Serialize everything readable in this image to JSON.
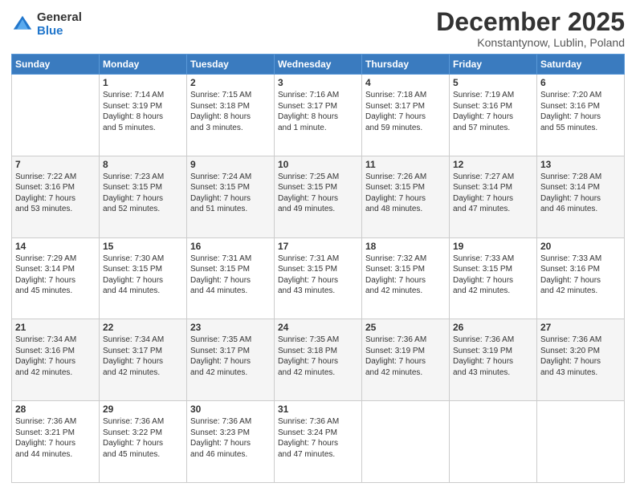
{
  "logo": {
    "general": "General",
    "blue": "Blue"
  },
  "header": {
    "month": "December 2025",
    "location": "Konstantynow, Lublin, Poland"
  },
  "weekdays": [
    "Sunday",
    "Monday",
    "Tuesday",
    "Wednesday",
    "Thursday",
    "Friday",
    "Saturday"
  ],
  "weeks": [
    [
      {
        "day": "",
        "info": ""
      },
      {
        "day": "1",
        "info": "Sunrise: 7:14 AM\nSunset: 3:19 PM\nDaylight: 8 hours\nand 5 minutes."
      },
      {
        "day": "2",
        "info": "Sunrise: 7:15 AM\nSunset: 3:18 PM\nDaylight: 8 hours\nand 3 minutes."
      },
      {
        "day": "3",
        "info": "Sunrise: 7:16 AM\nSunset: 3:17 PM\nDaylight: 8 hours\nand 1 minute."
      },
      {
        "day": "4",
        "info": "Sunrise: 7:18 AM\nSunset: 3:17 PM\nDaylight: 7 hours\nand 59 minutes."
      },
      {
        "day": "5",
        "info": "Sunrise: 7:19 AM\nSunset: 3:16 PM\nDaylight: 7 hours\nand 57 minutes."
      },
      {
        "day": "6",
        "info": "Sunrise: 7:20 AM\nSunset: 3:16 PM\nDaylight: 7 hours\nand 55 minutes."
      }
    ],
    [
      {
        "day": "7",
        "info": "Sunrise: 7:22 AM\nSunset: 3:16 PM\nDaylight: 7 hours\nand 53 minutes."
      },
      {
        "day": "8",
        "info": "Sunrise: 7:23 AM\nSunset: 3:15 PM\nDaylight: 7 hours\nand 52 minutes."
      },
      {
        "day": "9",
        "info": "Sunrise: 7:24 AM\nSunset: 3:15 PM\nDaylight: 7 hours\nand 51 minutes."
      },
      {
        "day": "10",
        "info": "Sunrise: 7:25 AM\nSunset: 3:15 PM\nDaylight: 7 hours\nand 49 minutes."
      },
      {
        "day": "11",
        "info": "Sunrise: 7:26 AM\nSunset: 3:15 PM\nDaylight: 7 hours\nand 48 minutes."
      },
      {
        "day": "12",
        "info": "Sunrise: 7:27 AM\nSunset: 3:14 PM\nDaylight: 7 hours\nand 47 minutes."
      },
      {
        "day": "13",
        "info": "Sunrise: 7:28 AM\nSunset: 3:14 PM\nDaylight: 7 hours\nand 46 minutes."
      }
    ],
    [
      {
        "day": "14",
        "info": "Sunrise: 7:29 AM\nSunset: 3:14 PM\nDaylight: 7 hours\nand 45 minutes."
      },
      {
        "day": "15",
        "info": "Sunrise: 7:30 AM\nSunset: 3:15 PM\nDaylight: 7 hours\nand 44 minutes."
      },
      {
        "day": "16",
        "info": "Sunrise: 7:31 AM\nSunset: 3:15 PM\nDaylight: 7 hours\nand 44 minutes."
      },
      {
        "day": "17",
        "info": "Sunrise: 7:31 AM\nSunset: 3:15 PM\nDaylight: 7 hours\nand 43 minutes."
      },
      {
        "day": "18",
        "info": "Sunrise: 7:32 AM\nSunset: 3:15 PM\nDaylight: 7 hours\nand 42 minutes."
      },
      {
        "day": "19",
        "info": "Sunrise: 7:33 AM\nSunset: 3:15 PM\nDaylight: 7 hours\nand 42 minutes."
      },
      {
        "day": "20",
        "info": "Sunrise: 7:33 AM\nSunset: 3:16 PM\nDaylight: 7 hours\nand 42 minutes."
      }
    ],
    [
      {
        "day": "21",
        "info": "Sunrise: 7:34 AM\nSunset: 3:16 PM\nDaylight: 7 hours\nand 42 minutes."
      },
      {
        "day": "22",
        "info": "Sunrise: 7:34 AM\nSunset: 3:17 PM\nDaylight: 7 hours\nand 42 minutes."
      },
      {
        "day": "23",
        "info": "Sunrise: 7:35 AM\nSunset: 3:17 PM\nDaylight: 7 hours\nand 42 minutes."
      },
      {
        "day": "24",
        "info": "Sunrise: 7:35 AM\nSunset: 3:18 PM\nDaylight: 7 hours\nand 42 minutes."
      },
      {
        "day": "25",
        "info": "Sunrise: 7:36 AM\nSunset: 3:19 PM\nDaylight: 7 hours\nand 42 minutes."
      },
      {
        "day": "26",
        "info": "Sunrise: 7:36 AM\nSunset: 3:19 PM\nDaylight: 7 hours\nand 43 minutes."
      },
      {
        "day": "27",
        "info": "Sunrise: 7:36 AM\nSunset: 3:20 PM\nDaylight: 7 hours\nand 43 minutes."
      }
    ],
    [
      {
        "day": "28",
        "info": "Sunrise: 7:36 AM\nSunset: 3:21 PM\nDaylight: 7 hours\nand 44 minutes."
      },
      {
        "day": "29",
        "info": "Sunrise: 7:36 AM\nSunset: 3:22 PM\nDaylight: 7 hours\nand 45 minutes."
      },
      {
        "day": "30",
        "info": "Sunrise: 7:36 AM\nSunset: 3:23 PM\nDaylight: 7 hours\nand 46 minutes."
      },
      {
        "day": "31",
        "info": "Sunrise: 7:36 AM\nSunset: 3:24 PM\nDaylight: 7 hours\nand 47 minutes."
      },
      {
        "day": "",
        "info": ""
      },
      {
        "day": "",
        "info": ""
      },
      {
        "day": "",
        "info": ""
      }
    ]
  ]
}
